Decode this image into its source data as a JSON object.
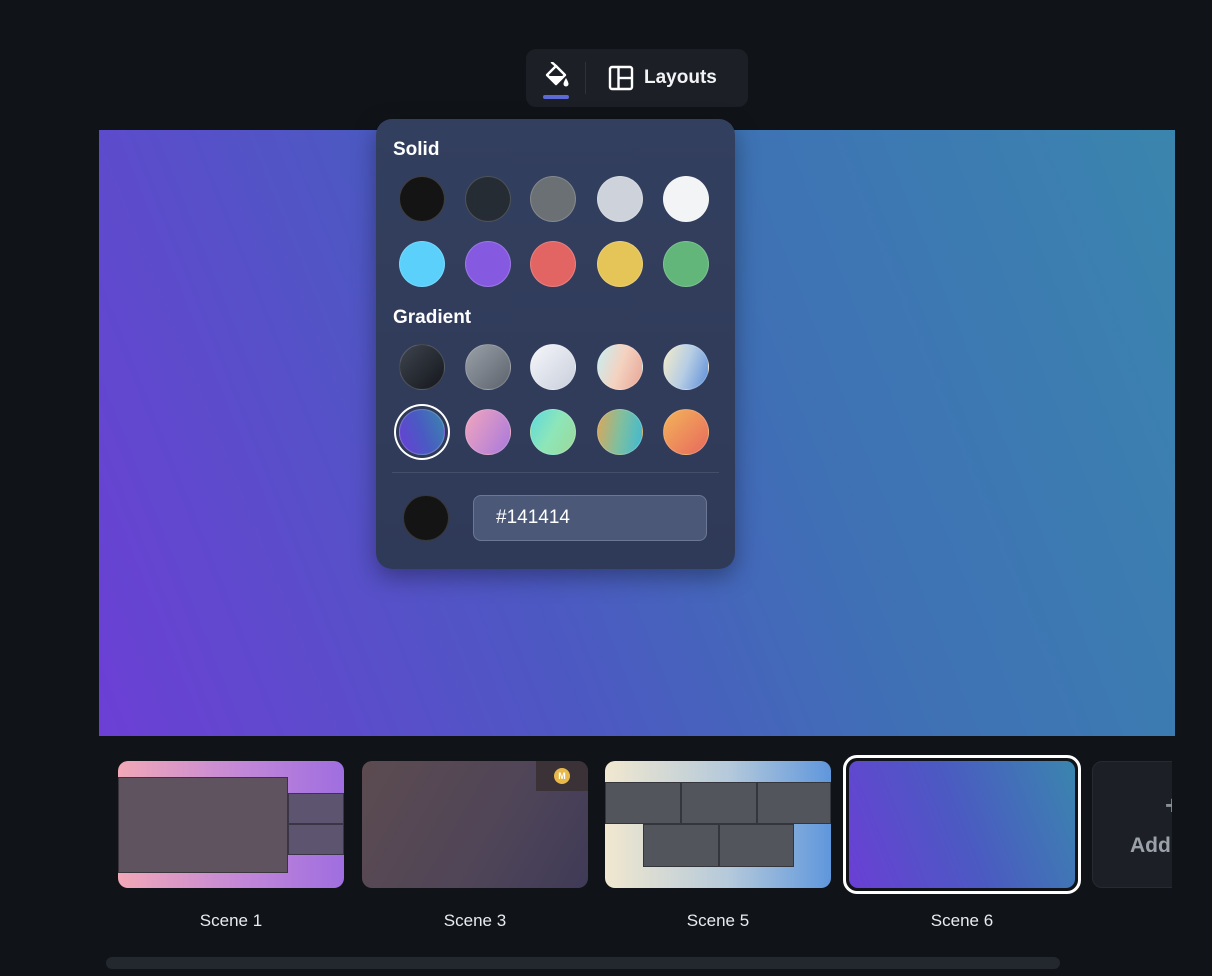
{
  "toolbar": {
    "paint_icon": "paint-bucket-icon",
    "layouts_icon": "layout-icon",
    "layouts_label": "Layouts",
    "accent_color": "#5b6ad6"
  },
  "canvas": {
    "background": "purple-to-teal gradient"
  },
  "color_picker": {
    "solid_title": "Solid",
    "gradient_title": "Gradient",
    "solid_colors": [
      "#141414",
      "#262c33",
      "#6b7075",
      "#ced3db",
      "#f3f4f6",
      "#5ad0fb",
      "#865ae0",
      "#e36563",
      "#e6c558",
      "#62b67a"
    ],
    "gradient_selected_index": 5,
    "hex_value": "#141414",
    "current_color": "#141414"
  },
  "scenes": [
    {
      "label": "Scene 1",
      "selected": false
    },
    {
      "label": "Scene 3",
      "selected": false,
      "badge": "M"
    },
    {
      "label": "Scene 5",
      "selected": false
    },
    {
      "label": "Scene 6",
      "selected": true
    }
  ],
  "add_scene": {
    "label": "Add",
    "icon": "plus-icon"
  }
}
